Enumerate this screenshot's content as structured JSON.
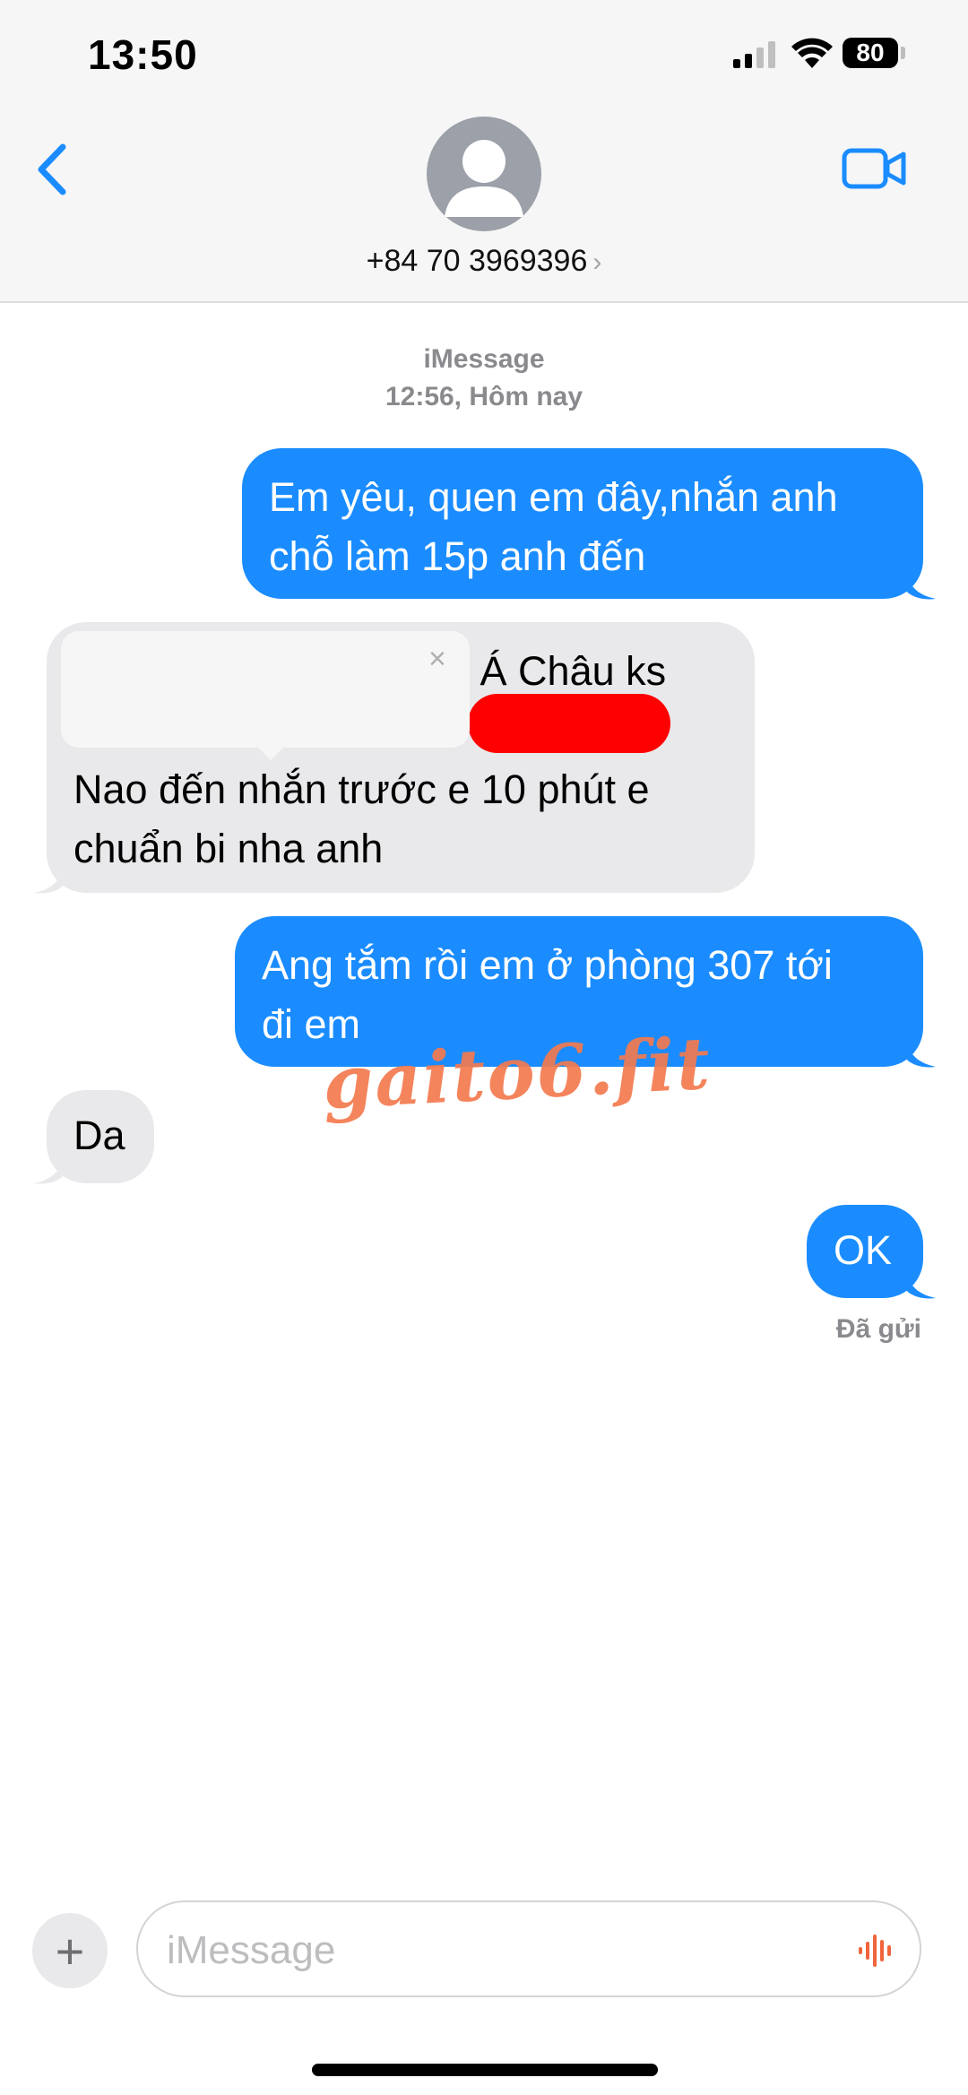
{
  "status_bar": {
    "time": "13:50",
    "battery": "80"
  },
  "header": {
    "contact": "+84 70 3969396",
    "chevron": "›"
  },
  "conversation": {
    "service": "iMessage",
    "timestamp": "12:56, Hôm nay"
  },
  "messages": [
    {
      "direction": "outgoing",
      "lines": [
        "Em yêu, quen em đây,nhắn anh",
        "chỗ làm 15p anh đến"
      ]
    },
    {
      "direction": "incoming",
      "lines": [
        "u Á Châu ks",
        "Nao đến nhắn trước e 10 phút e",
        "chuẩn bi nha anh"
      ]
    },
    {
      "direction": "outgoing",
      "lines": [
        "Ang tắm rồi em ở phòng 307 tới",
        "đi em"
      ]
    },
    {
      "direction": "incoming",
      "lines": [
        "Da"
      ]
    },
    {
      "direction": "outgoing",
      "lines": [
        "OK"
      ]
    }
  ],
  "popup": {
    "close": "×"
  },
  "delivery_status": "Đã gửi",
  "watermark": "gaito6.fit",
  "input": {
    "placeholder": "iMessage",
    "value": "",
    "plus": "+"
  },
  "icons": {
    "back": "chevron-left-icon",
    "video": "video-camera-icon",
    "mic": "audio-waveform-icon"
  },
  "colors": {
    "accent": "#1a8cff",
    "incoming_bubble": "#e9e9eb",
    "redaction": "#ff0000",
    "watermark": "#f47a4f"
  }
}
